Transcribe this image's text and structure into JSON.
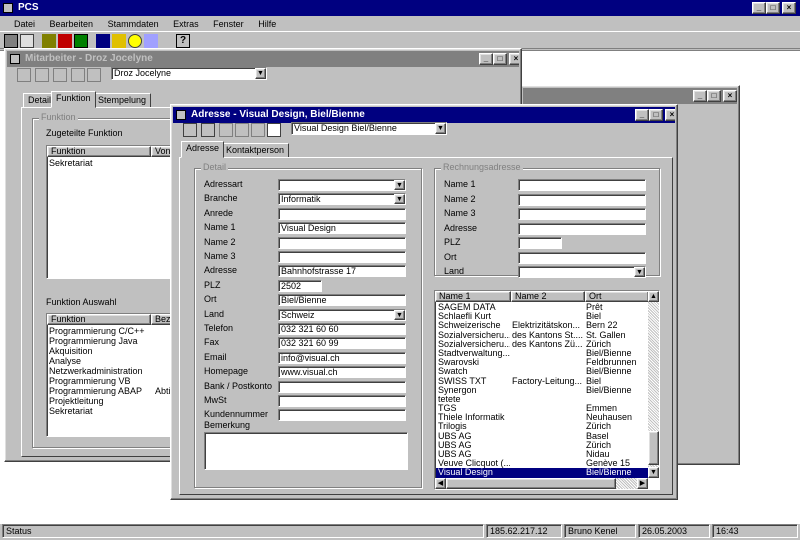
{
  "app": {
    "title": "PCS"
  },
  "menu": [
    "Datei",
    "Bearbeiten",
    "Stammdaten",
    "Extras",
    "Fenster",
    "Hilfe"
  ],
  "employee_window": {
    "title": "Mitarbeiter - Droz Jocelyne",
    "employee": "Droz Jocelyne",
    "tabs": [
      "Detail",
      "Funktion",
      "Stempelung"
    ],
    "group_title": "Funktion",
    "assigned_label": "Zugeteilte Funktion",
    "assigned_headers": [
      "Funktion",
      "Von"
    ],
    "assigned_rows": [
      "Sekretariat"
    ],
    "selection_label": "Funktion Auswahl",
    "selection_headers": [
      "Funktion",
      "Bez"
    ],
    "selection_rows": [
      {
        "name": "Programmierung C/C++",
        "extra": ""
      },
      {
        "name": "Programmierung Java",
        "extra": ""
      },
      {
        "name": "Akquisition",
        "extra": ""
      },
      {
        "name": "Analyse",
        "extra": ""
      },
      {
        "name": "Netzwerkadministration",
        "extra": ""
      },
      {
        "name": "Programmierung VB",
        "extra": ""
      },
      {
        "name": "Programmierung ABAP",
        "extra": "Abti"
      },
      {
        "name": "Projektleitung",
        "extra": ""
      },
      {
        "name": "Sekretariat",
        "extra": ""
      }
    ]
  },
  "address_window": {
    "title": "Adresse - Visual Design, Biel/Bienne",
    "combo": "Visual Design Biel/Bienne",
    "tabs": [
      "Adresse",
      "Kontaktperson"
    ],
    "detail_title": "Detail",
    "fields": [
      {
        "label": "Adressart",
        "value": "",
        "type": "combo"
      },
      {
        "label": "Branche",
        "value": "Informatik",
        "type": "combo"
      },
      {
        "label": "Anrede",
        "value": "",
        "type": "text"
      },
      {
        "label": "Name 1",
        "value": "Visual Design",
        "type": "text"
      },
      {
        "label": "Name 2",
        "value": "",
        "type": "text"
      },
      {
        "label": "Name 3",
        "value": "",
        "type": "text"
      },
      {
        "label": "Adresse",
        "value": "Bahnhofstrasse 17",
        "type": "text"
      },
      {
        "label": "PLZ",
        "value": "2502",
        "type": "short"
      },
      {
        "label": "Ort",
        "value": "Biel/Bienne",
        "type": "text"
      },
      {
        "label": "Land",
        "value": "Schweiz",
        "type": "combo"
      },
      {
        "label": "Telefon",
        "value": "032 321 60 60",
        "type": "text"
      },
      {
        "label": "Fax",
        "value": "032 321 60 99",
        "type": "text"
      },
      {
        "label": "Email",
        "value": "info@visual.ch",
        "type": "text"
      },
      {
        "label": "Homepage",
        "value": "www.visual.ch",
        "type": "text"
      },
      {
        "label": "Bank / Postkonto",
        "value": "",
        "type": "text"
      },
      {
        "label": "MwSt",
        "value": "",
        "type": "text"
      },
      {
        "label": "Kundennummer",
        "value": "",
        "type": "text"
      }
    ],
    "remark_label": "Bemerkung",
    "billing_title": "Rechnungsadresse",
    "billing_fields": [
      {
        "label": "Name 1",
        "type": "text"
      },
      {
        "label": "Name 2",
        "type": "text"
      },
      {
        "label": "Name 3",
        "type": "text"
      },
      {
        "label": "Adresse",
        "type": "text"
      },
      {
        "label": "PLZ",
        "type": "short"
      },
      {
        "label": "Ort",
        "type": "text"
      },
      {
        "label": "Land",
        "type": "combo"
      }
    ],
    "list_headers": [
      "Name 1",
      "Name 2",
      "Ort"
    ],
    "list_rows": [
      {
        "n1": "SAGEM DATA",
        "n2": "",
        "ort": "Prêt"
      },
      {
        "n1": "Schlaefli Kurt",
        "n2": "",
        "ort": "Biel"
      },
      {
        "n1": "Schweizerische",
        "n2": "Elektrizitätskon...",
        "ort": "Bern 22"
      },
      {
        "n1": "Sozialversicheru...",
        "n2": "des Kantons St....",
        "ort": "St. Gallen"
      },
      {
        "n1": "Sozialversicheru...",
        "n2": "des Kantons Zü...",
        "ort": "Zürich"
      },
      {
        "n1": "Stadtverwaltung...",
        "n2": "",
        "ort": "Biel/Bienne"
      },
      {
        "n1": "Swarovski",
        "n2": "",
        "ort": "Feldbrunnen"
      },
      {
        "n1": "Swatch",
        "n2": "",
        "ort": "Biel/Bienne"
      },
      {
        "n1": "SWISS TXT",
        "n2": "Factory-Leitung...",
        "ort": "Biel"
      },
      {
        "n1": "Synergon",
        "n2": "",
        "ort": "Biel/Bienne"
      },
      {
        "n1": "tetete",
        "n2": "",
        "ort": ""
      },
      {
        "n1": "TGS",
        "n2": "",
        "ort": "Emmen"
      },
      {
        "n1": "Thiele Informatik",
        "n2": "",
        "ort": "Neuhausen"
      },
      {
        "n1": "Trilogis",
        "n2": "",
        "ort": "Zürich"
      },
      {
        "n1": "UBS AG",
        "n2": "",
        "ort": "Basel"
      },
      {
        "n1": "UBS AG",
        "n2": "",
        "ort": "Zürich"
      },
      {
        "n1": "UBS AG",
        "n2": "",
        "ort": "Nidau"
      },
      {
        "n1": "Veuve Clicquot (...",
        "n2": "",
        "ort": "Genève 15"
      },
      {
        "n1": "Visual Design",
        "n2": "",
        "ort": "Biel/Bienne",
        "selected": true
      }
    ]
  },
  "statusbar": {
    "status": "Status",
    "ip": "185.62.217.12",
    "user": "Bruno Kenel",
    "date": "26.05.2003",
    "time": "16:43"
  }
}
